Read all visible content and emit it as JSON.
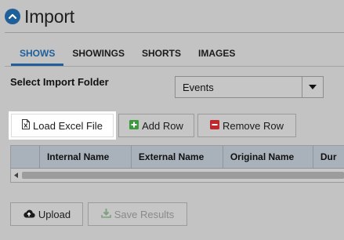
{
  "page": {
    "title": "Import"
  },
  "tabs": [
    {
      "label": "SHOWS",
      "active": true
    },
    {
      "label": "SHOWINGS",
      "active": false
    },
    {
      "label": "SHORTS",
      "active": false
    },
    {
      "label": "IMAGES",
      "active": false
    }
  ],
  "folder": {
    "label": "Select Import Folder",
    "selected": "Events"
  },
  "toolbar": {
    "load_label": "Load Excel File",
    "add_label": "Add Row",
    "remove_label": "Remove Row"
  },
  "grid": {
    "columns": [
      "",
      "Internal Name",
      "External Name",
      "Original Name",
      "Dur"
    ]
  },
  "footer": {
    "upload_label": "Upload",
    "save_label": "Save Results"
  },
  "icons": {
    "title": "chevron-up-circle-icon",
    "caret": "caret-down-icon",
    "load": "excel-file-icon",
    "add": "plus-square-icon",
    "remove": "minus-square-icon",
    "upload": "cloud-upload-icon",
    "save": "download-icon",
    "scroll": "scroll-left-icon"
  },
  "colors": {
    "accent": "#1f5f9a",
    "add_green": "#3c9a3c",
    "remove_red": "#c0282d",
    "background": "#c3c3c3"
  }
}
